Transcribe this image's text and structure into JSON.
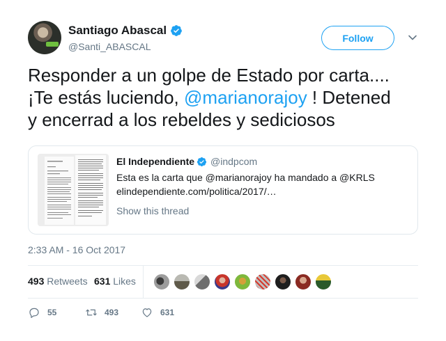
{
  "author": {
    "name": "Santiago Abascal",
    "handle": "@Santi_ABASCAL",
    "verified": true
  },
  "follow_label": "Follow",
  "tweet": {
    "line1": "Responder a un golpe de Estado por carta....",
    "line2_pre": "¡Te estás luciendo, ",
    "line2_mention": "@marianorajoy",
    "line2_post": " ! Detened",
    "line3": "y encerrad a los rebeldes y sediciosos"
  },
  "quote": {
    "name": "El Independiente",
    "handle": "@indpcom",
    "text_line1": "Esta es la carta que @marianorajoy  ha mandado a @KRLS",
    "text_line2": "elindependiente.com/politica/2017/…",
    "show_thread": "Show this thread"
  },
  "timestamp": "2:33 AM - 16 Oct 2017",
  "stats": {
    "retweets_count": "493",
    "retweets_label": "Retweets",
    "likes_count": "631",
    "likes_label": "Likes"
  },
  "likers_icons": [
    "avatar-icon",
    "avatar-icon",
    "avatar-icon",
    "avatar-icon",
    "avatar-icon",
    "avatar-icon",
    "avatar-icon",
    "avatar-icon",
    "avatar-icon"
  ],
  "actions": {
    "reply_count": "55",
    "retweet_count": "493",
    "like_count": "631"
  },
  "colors": {
    "accent": "#1da1f2",
    "muted": "#657786"
  }
}
